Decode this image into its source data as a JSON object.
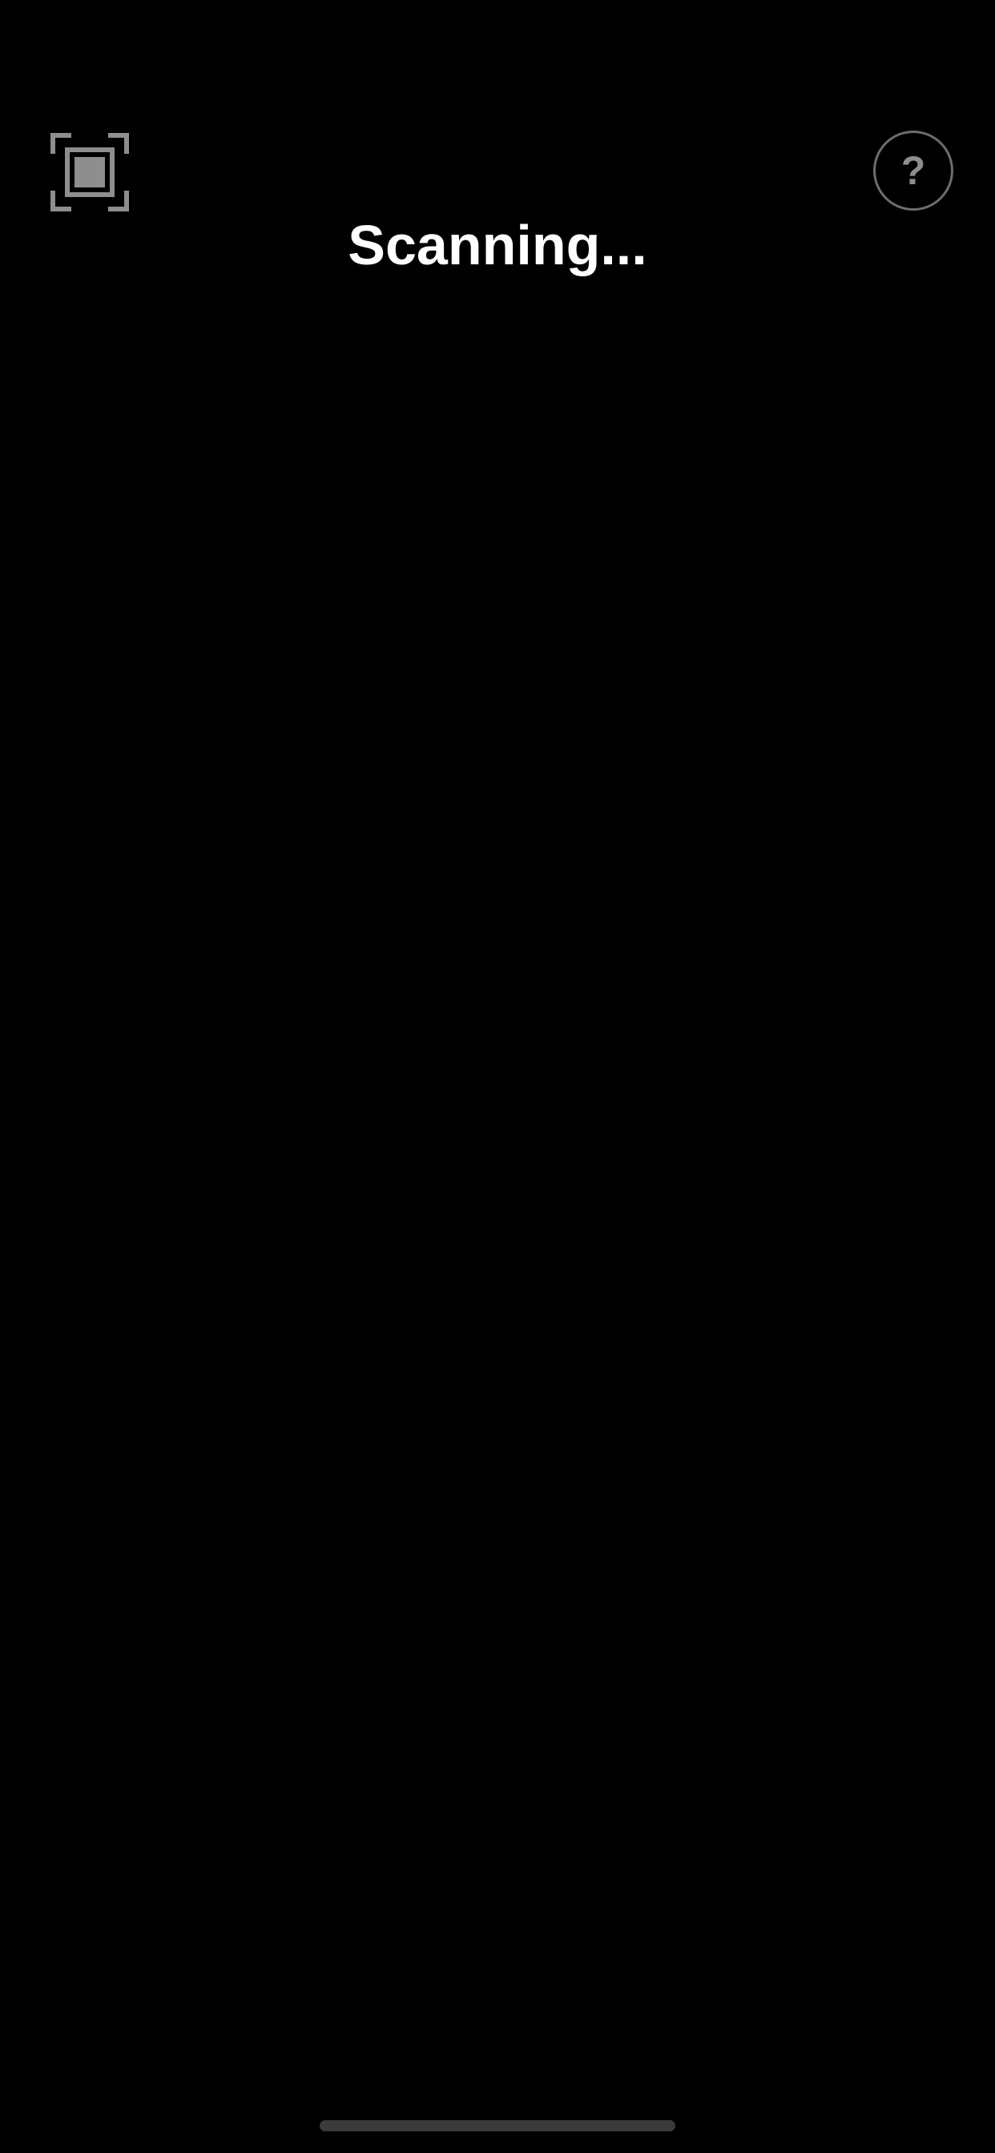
{
  "header": {
    "title": "Scanning...",
    "scan_icon": "scan-frame-icon",
    "help_icon": "question-mark-icon",
    "help_glyph": "?"
  },
  "colors": {
    "background": "#000000",
    "title_text": "#ffffff",
    "icon_gray": "#8e8e8e",
    "help_border": "#6d6d6d",
    "home_indicator": "#3a3a3a"
  }
}
